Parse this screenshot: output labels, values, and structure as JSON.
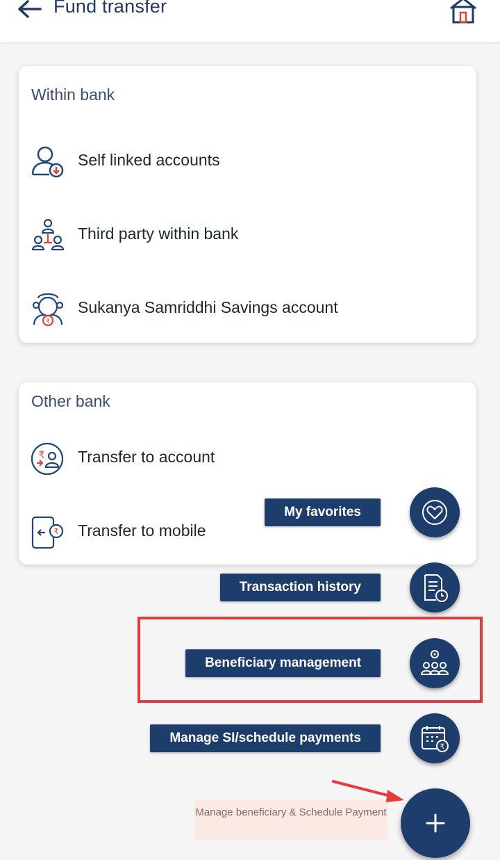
{
  "header": {
    "title": "Fund transfer",
    "back_icon": "arrow-left-icon",
    "home_icon": "home-icon"
  },
  "within_bank": {
    "title": "Within bank",
    "options": [
      {
        "label": "Self linked accounts",
        "icon": "user-download-icon"
      },
      {
        "label": "Third party within bank",
        "icon": "user-network-icon"
      },
      {
        "label": "Sukanya Samriddhi Savings account",
        "icon": "girl-child-rupee-icon"
      }
    ]
  },
  "other_bank": {
    "title": "Other bank",
    "options": [
      {
        "label": "Transfer to account",
        "icon": "rupee-user-transfer-icon"
      },
      {
        "label": "Transfer to mobile",
        "icon": "mobile-transfer-icon"
      }
    ]
  },
  "fab_menu": {
    "items": [
      {
        "label": "My favorites",
        "icon": "heart-icon"
      },
      {
        "label": "Transaction history",
        "icon": "document-clock-icon"
      },
      {
        "label": "Beneficiary management",
        "icon": "users-gear-icon"
      },
      {
        "label": "Manage SI/schedule payments",
        "icon": "calendar-rupee-icon"
      }
    ],
    "main_icon": "plus-icon",
    "tooltip": "Manage beneficiary & Schedule Payment"
  },
  "colors": {
    "navy": "#1d3e6d",
    "accent_red": "#e8393c",
    "icon_blue": "#21477a",
    "icon_red": "#d9453c",
    "tooltip_bg": "#fbe9e4"
  }
}
